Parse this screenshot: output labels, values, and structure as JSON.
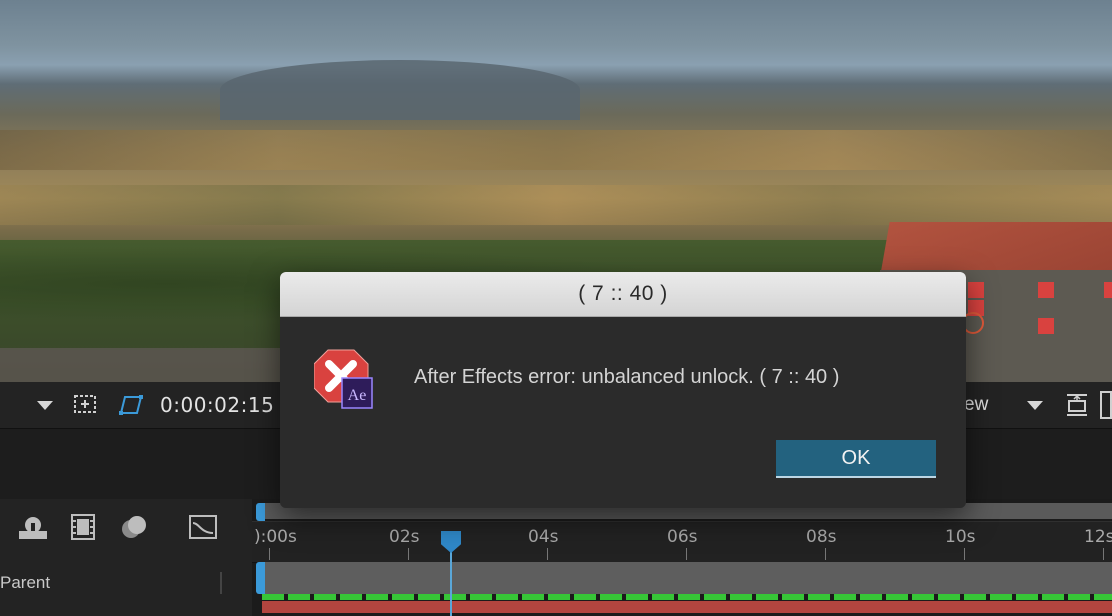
{
  "viewer_toolbar": {
    "timecode": "0:00:02:15",
    "view_label": "ew"
  },
  "timeline": {
    "ruler_labels": [
      "):00s",
      "02s",
      "04s",
      "06s",
      "08s",
      "10s",
      "12s"
    ],
    "parent_column_label": "Parent",
    "current_time_seconds": 2.6
  },
  "dialog": {
    "title": "( 7 :: 40 )",
    "message": "After Effects error: unbalanced unlock. ( 7 :: 40 )",
    "ok_label": "OK",
    "app_badge": "Ae"
  },
  "colors": {
    "ok_button": "#23627f",
    "error_icon": "#d9423f",
    "ae_badge": "#2e1c5a",
    "accent_blue": "#3b9ad9",
    "green_track": "#37c637",
    "red_track": "#b2453f"
  },
  "icons": [
    "chevron-down-icon",
    "region-of-interest-icon",
    "transparency-grid-icon",
    "fit-icon",
    "solo-icon",
    "motion-blur-icon",
    "frame-blend-icon",
    "graph-editor-icon",
    "error-icon"
  ]
}
